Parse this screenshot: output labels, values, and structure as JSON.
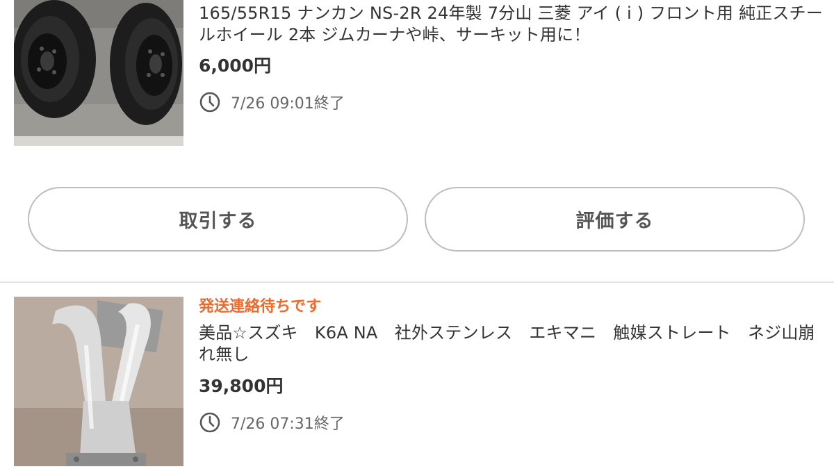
{
  "items": [
    {
      "title": "165/55R15 ナンカン NS-2R 24年製 7分山 三菱 アイ ( i ) フロント用 純正スチールホイール 2本 ジムカーナや峠、サーキット用に！",
      "price": "6,000円",
      "end_time": "7/26 09:01終了",
      "image_alt": "tires-photo"
    },
    {
      "status": "発送連絡待ちです",
      "title": "美品☆スズキ　K6A NA　社外ステンレス　エキマニ　触媒ストレート　ネジ山崩れ無し",
      "price": "39,800円",
      "end_time": "7/26 07:31終了",
      "image_alt": "exhaust-manifold-photo"
    }
  ],
  "actions": {
    "trade_label": "取引する",
    "rate_label": "評価する"
  },
  "colors": {
    "status": "#ee6a2c",
    "button_border": "#bdbdbd",
    "divider": "#e4e4e4"
  }
}
